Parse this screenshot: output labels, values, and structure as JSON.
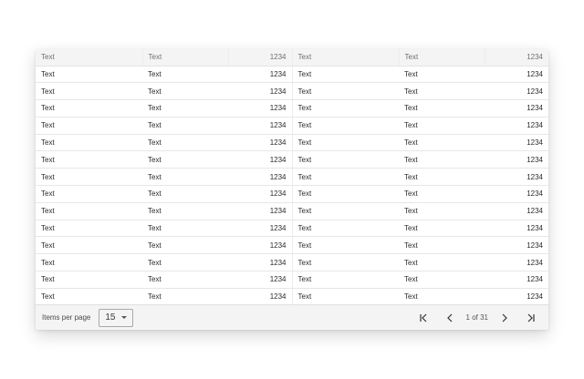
{
  "table": {
    "headers": [
      "Text",
      "Text",
      "1234",
      "Text",
      "Text",
      "1234"
    ],
    "rows": [
      [
        "Text",
        "Text",
        "1234",
        "Text",
        "Text",
        "1234"
      ],
      [
        "Text",
        "Text",
        "1234",
        "Text",
        "Text",
        "1234"
      ],
      [
        "Text",
        "Text",
        "1234",
        "Text",
        "Text",
        "1234"
      ],
      [
        "Text",
        "Text",
        "1234",
        "Text",
        "Text",
        "1234"
      ],
      [
        "Text",
        "Text",
        "1234",
        "Text",
        "Text",
        "1234"
      ],
      [
        "Text",
        "Text",
        "1234",
        "Text",
        "Text",
        "1234"
      ],
      [
        "Text",
        "Text",
        "1234",
        "Text",
        "Text",
        "1234"
      ],
      [
        "Text",
        "Text",
        "1234",
        "Text",
        "Text",
        "1234"
      ],
      [
        "Text",
        "Text",
        "1234",
        "Text",
        "Text",
        "1234"
      ],
      [
        "Text",
        "Text",
        "1234",
        "Text",
        "Text",
        "1234"
      ],
      [
        "Text",
        "Text",
        "1234",
        "Text",
        "Text",
        "1234"
      ],
      [
        "Text",
        "Text",
        "1234",
        "Text",
        "Text",
        "1234"
      ],
      [
        "Text",
        "Text",
        "1234",
        "Text",
        "Text",
        "1234"
      ],
      [
        "Text",
        "Text",
        "1234",
        "Text",
        "Text",
        "1234"
      ]
    ]
  },
  "footer": {
    "items_per_page_label": "Items per page",
    "items_per_page_value": "15",
    "page_info": "1 of 31",
    "icons": [
      "first-page-icon",
      "previous-page-icon",
      "next-page-icon",
      "last-page-icon"
    ]
  }
}
